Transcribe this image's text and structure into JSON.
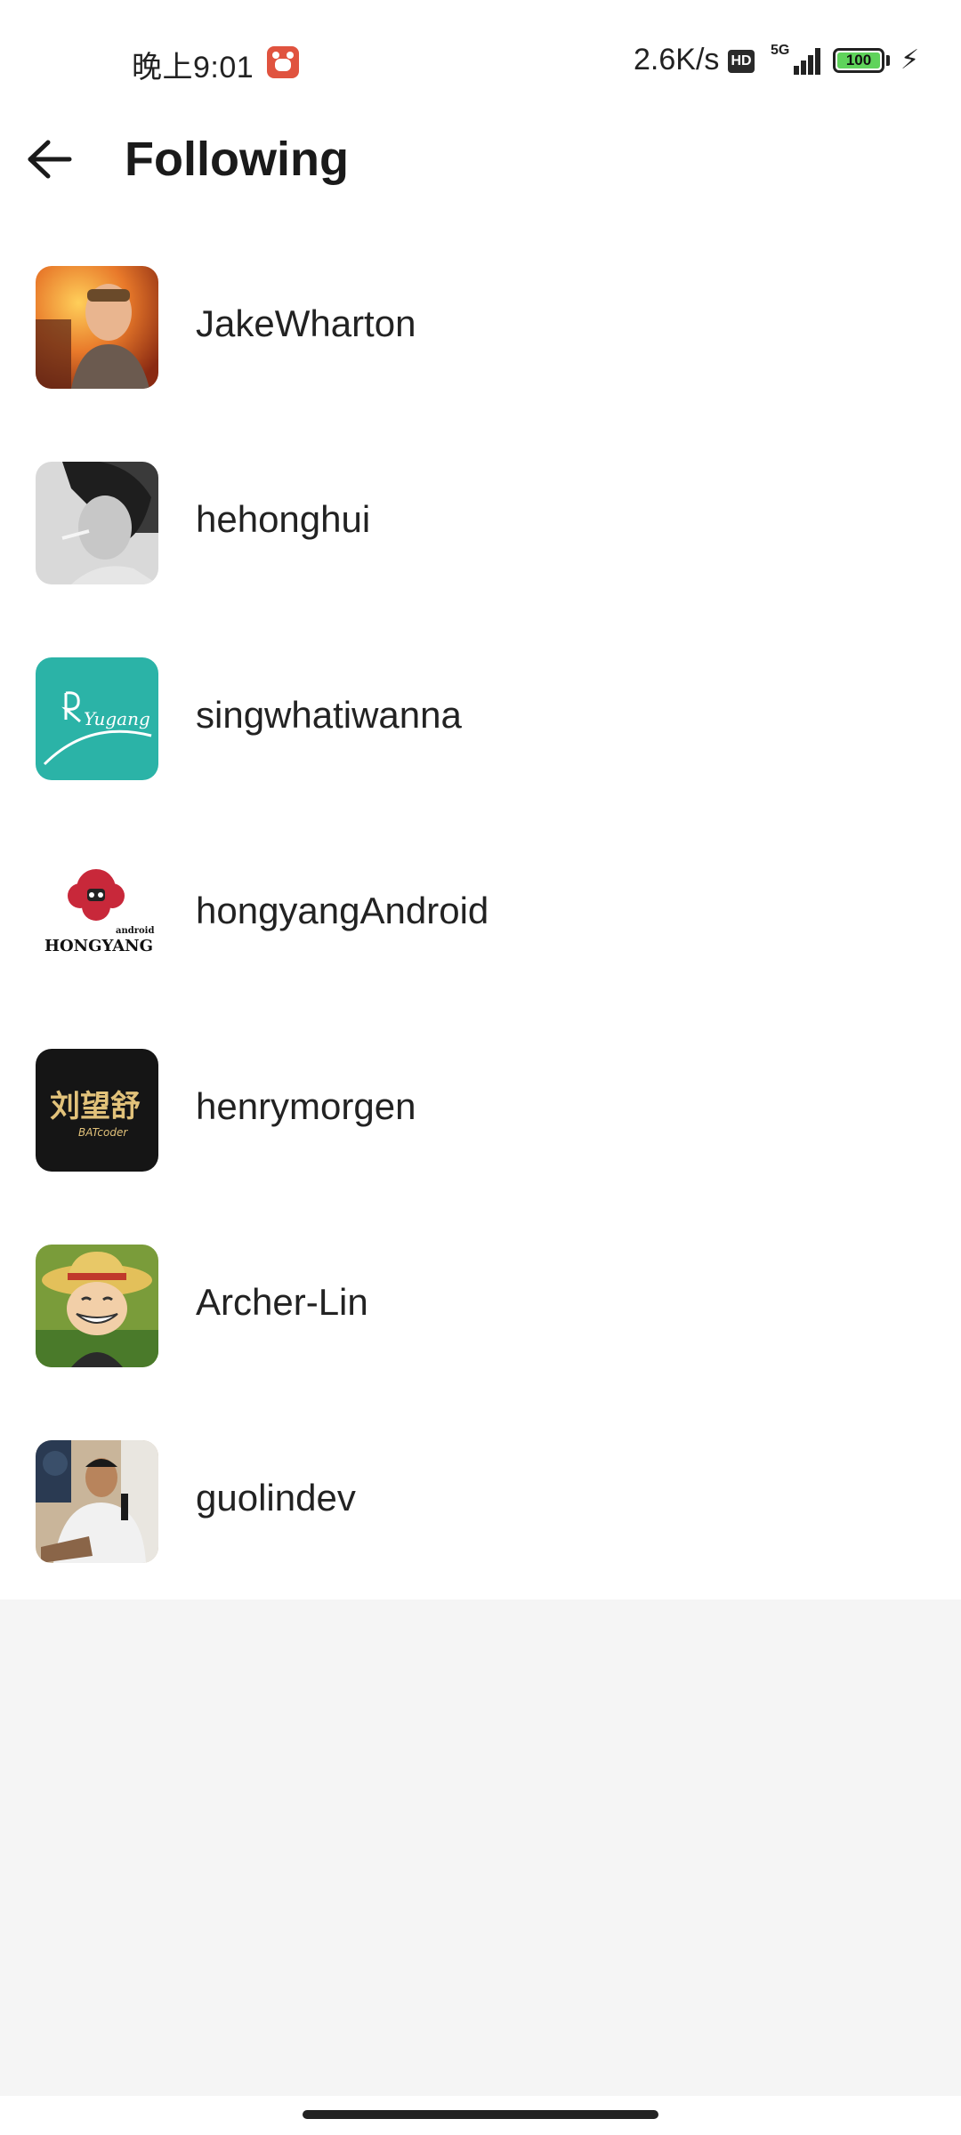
{
  "status_bar": {
    "time": "晚上9:01",
    "net_speed": "2.6K/s",
    "hd": "HD",
    "network": "5G",
    "battery": "100",
    "battery_level_percent": 100
  },
  "toolbar": {
    "title": "Following"
  },
  "following": [
    {
      "username": "JakeWharton",
      "avatar": "photo-jakewharton"
    },
    {
      "username": "hehonghui",
      "avatar": "photo-hehonghui"
    },
    {
      "username": "singwhatiwanna",
      "avatar": "logo-yugang"
    },
    {
      "username": "hongyangAndroid",
      "avatar": "logo-hongyang",
      "avatar_text": "HONGYANG",
      "avatar_subtext": "android"
    },
    {
      "username": "henrymorgen",
      "avatar": "logo-batcoder",
      "avatar_text": "刘望舒",
      "avatar_subtext": "BATcoder"
    },
    {
      "username": "Archer-Lin",
      "avatar": "cartoon-archer"
    },
    {
      "username": "guolindev",
      "avatar": "photo-guolindev"
    }
  ],
  "colors": {
    "background": "#f5f5f5",
    "surface": "#ffffff",
    "text": "#222222",
    "battery_fill": "#5fd35b",
    "yugang_teal": "#2bb3a7"
  }
}
